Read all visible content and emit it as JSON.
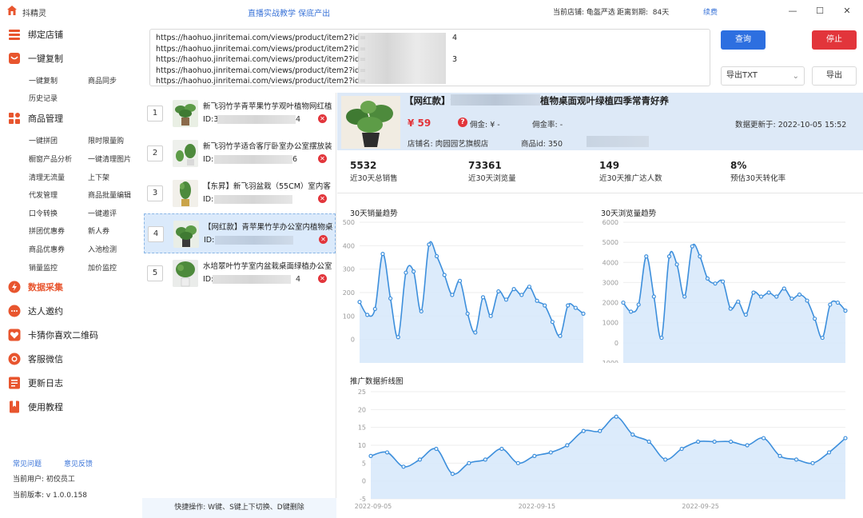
{
  "titlebar": {
    "app_name": "抖精灵",
    "center_text": "直播实战教学 保底产出",
    "shop_label": "当前店铺:",
    "shop_name": "龟盔严选",
    "expire_label": "距离到期:",
    "expire_days": "84天",
    "renew_label": "续费",
    "minimize": "—",
    "maximize": "☐",
    "close": "✕"
  },
  "sidebar": {
    "nav": [
      {
        "label": "绑定店铺",
        "icon": "stack-icon",
        "color": "#e8552e"
      },
      {
        "label": "一键复制",
        "icon": "bag-icon",
        "color": "#e8552e"
      },
      {
        "label": "商品管理",
        "icon": "grid-icon",
        "color": "#e8552e"
      },
      {
        "label": "数据采集",
        "icon": "bolt-icon",
        "color": "#e8552e"
      },
      {
        "label": "达人邀约",
        "icon": "chat-icon",
        "color": "#e8552e"
      },
      {
        "label": "卡猜你喜欢二维码",
        "icon": "heart-icon",
        "color": "#e8552e"
      },
      {
        "label": "客服微信",
        "icon": "support-icon",
        "color": "#e8552e"
      },
      {
        "label": "更新日志",
        "icon": "list-icon",
        "color": "#e8552e"
      },
      {
        "label": "使用教程",
        "icon": "book-icon",
        "color": "#e8552e"
      }
    ],
    "copy_sub": [
      "一键复制",
      "商品同步",
      "历史记录"
    ],
    "manage_sub": [
      "一键拼团",
      "限时限量购",
      "橱窗产品分析",
      "一键清理图片",
      "清理无流量",
      "上下架",
      "代发管理",
      "商品批量编辑",
      "口令转换",
      "一键邀评",
      "拼团优惠券",
      "新人券",
      "商品优惠券",
      "入池检测",
      "销量监控",
      "加价监控"
    ],
    "faq": "常见问题",
    "feedback": "意见反馈",
    "user": "当前用户: 初佼员工",
    "version": "当前版本: v 1.0.0.158"
  },
  "urls": [
    "https://haohuo.jinritemai.com/views/product/item2?id=",
    "https://haohuo.jinritemai.com/views/product/item2?id=",
    "https://haohuo.jinritemai.com/views/product/item2?id=",
    "https://haohuo.jinritemai.com/views/product/item2?id=",
    "https://haohuo.jinritemai.com/views/product/item2?id="
  ],
  "url_suffix": [
    "4",
    "",
    "3",
    "",
    ""
  ],
  "actions": {
    "query": "查询",
    "stop": "停止",
    "export_format": "导出TXT",
    "export": "导出"
  },
  "products": [
    {
      "num": "1",
      "title": "新飞羽竹芋青苹果竹芋观叶植物网红植",
      "id_prefix": "ID:35",
      "id_suffix": "4"
    },
    {
      "num": "2",
      "title": "新飞羽竹芋适合客厅卧室办公室摆放装",
      "id_prefix": "ID:3",
      "id_suffix": "6"
    },
    {
      "num": "3",
      "title": "【东昇】新飞羽盆栽（55CM）室内客",
      "id_prefix": "ID:3",
      "id_suffix": ""
    },
    {
      "num": "4",
      "title": "【网红款】青苹果竹芋办公室内植物桌",
      "id_prefix": "ID:3",
      "id_suffix": ""
    },
    {
      "num": "5",
      "title": "水培翠叶竹芋室内盆栽桌面绿植办公室",
      "id_prefix": "ID:",
      "id_suffix": "4"
    }
  ],
  "shortcut": "快捷操作: W键、S键上下切换、D键删除",
  "detail": {
    "title_a": "【网红款】青",
    "title_b": "植物桌面观叶绿植四季常青好养",
    "price": "¥ 59",
    "commission": "佣金: ¥ -",
    "commission_rate": "佣金率:  -",
    "update": "数据更新于:  2022-10-05 15:52",
    "shop": "店铺名:  肉园园艺旗舰店",
    "pid": "商品id:  350"
  },
  "stats": [
    {
      "value": "5532",
      "label": "近30天总销售"
    },
    {
      "value": "73361",
      "label": "近30天浏览量"
    },
    {
      "value": "149",
      "label": "近30天推广达人数"
    },
    {
      "value": "8%",
      "label": "预估30天转化率"
    }
  ],
  "chart_data": [
    {
      "type": "area",
      "title": "30天销量趋势",
      "ylim": [
        -100,
        500
      ],
      "yticks": [
        500,
        400,
        300,
        200,
        100,
        0
      ],
      "values": [
        160,
        105,
        130,
        365,
        175,
        10,
        285,
        290,
        120,
        405,
        355,
        275,
        190,
        250,
        110,
        30,
        180,
        100,
        205,
        170,
        215,
        190,
        225,
        165,
        145,
        75,
        15,
        145,
        135,
        110
      ],
      "color": "#3d8fdc"
    },
    {
      "type": "area",
      "title": "30天浏览量趋势",
      "ylim": [
        -1000,
        6000
      ],
      "yticks": [
        6000,
        5000,
        4000,
        3000,
        2000,
        1000,
        0,
        -1000
      ],
      "values": [
        2000,
        1550,
        1900,
        4300,
        2300,
        250,
        4300,
        3900,
        2300,
        4800,
        4300,
        3200,
        2950,
        3050,
        1700,
        2050,
        1400,
        2500,
        2300,
        2500,
        2300,
        2700,
        2200,
        2400,
        2100,
        1200,
        250,
        1900,
        2000,
        1600
      ],
      "color": "#3d8fdc"
    },
    {
      "type": "area",
      "title": "推广数据折线图",
      "ylim": [
        -5,
        25
      ],
      "yticks": [
        25,
        20,
        15,
        10,
        5,
        0,
        -5
      ],
      "x": [
        "2022-09-05",
        "2022-09-15",
        "2022-09-25"
      ],
      "values": [
        7,
        8,
        4,
        6,
        9,
        2,
        5,
        6,
        9,
        5,
        7,
        8,
        10,
        14,
        14,
        18,
        13,
        11,
        6,
        9,
        11,
        11,
        11,
        10,
        12,
        7,
        6,
        5,
        8,
        12
      ],
      "color": "#3d8fdc"
    }
  ]
}
